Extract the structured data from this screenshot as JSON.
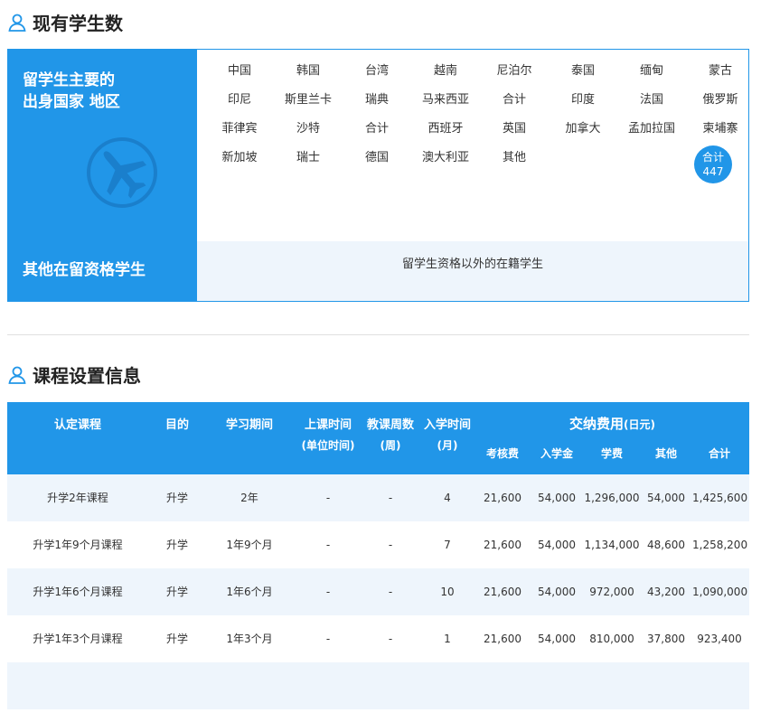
{
  "section1": {
    "title": "现有学生数"
  },
  "countries": {
    "heading_line1": "留学生主要的",
    "heading_line2": "出身国家 地区",
    "rows": [
      [
        "中国",
        "韩国",
        "台湾",
        "越南",
        "尼泊尔",
        "泰国",
        "缅甸",
        "蒙古"
      ],
      [
        "印尼",
        "斯里兰卡",
        "瑞典",
        "马来西亚",
        "合计",
        "印度",
        "法国",
        "俄罗斯"
      ],
      [
        "菲律宾",
        "沙特",
        "合计",
        "西班牙",
        "英国",
        "加拿大",
        "孟加拉国",
        "柬埔寨"
      ],
      [
        "新加坡",
        "瑞士",
        "德国",
        "澳大利亚",
        "其他",
        "",
        "",
        ""
      ]
    ],
    "total_label": "合计",
    "total_value": "447",
    "other_heading": "其他在留资格学生",
    "other_desc": "留学生资格以外的在籍学生"
  },
  "section2": {
    "title": "课程设置信息"
  },
  "course_table": {
    "headers": {
      "course": "认定课程",
      "purpose": "目的",
      "period": "学习期间",
      "class_time": "上课时间",
      "class_time_unit": "(单位时间)",
      "weeks": "教课周数",
      "weeks_unit": "(周)",
      "entry": "入学时间",
      "entry_unit": "(月)",
      "fees_group": "交纳费用",
      "fees_unit": "(日元)",
      "exam": "考核费",
      "admission": "入学金",
      "tuition": "学费",
      "other": "其他",
      "total": "合计"
    },
    "rows": [
      {
        "course": "升学2年课程",
        "purpose": "升学",
        "period": "2年",
        "class_time": "-",
        "weeks": "-",
        "entry": "4",
        "exam": "21,600",
        "admission": "54,000",
        "tuition": "1,296,000",
        "other": "54,000",
        "total": "1,425,600"
      },
      {
        "course": "升学1年9个月课程",
        "purpose": "升学",
        "period": "1年9个月",
        "class_time": "-",
        "weeks": "-",
        "entry": "7",
        "exam": "21,600",
        "admission": "54,000",
        "tuition": "1,134,000",
        "other": "48,600",
        "total": "1,258,200"
      },
      {
        "course": "升学1年6个月课程",
        "purpose": "升学",
        "period": "1年6个月",
        "class_time": "-",
        "weeks": "-",
        "entry": "10",
        "exam": "21,600",
        "admission": "54,000",
        "tuition": "972,000",
        "other": "43,200",
        "total": "1,090,000"
      },
      {
        "course": "升学1年3个月课程",
        "purpose": "升学",
        "period": "1年3个月",
        "class_time": "-",
        "weeks": "-",
        "entry": "1",
        "exam": "21,600",
        "admission": "54,000",
        "tuition": "810,000",
        "other": "37,800",
        "total": "923,400"
      }
    ]
  },
  "colors": {
    "accent": "#2196e8",
    "row_alt": "#eef5fc"
  },
  "icons": {
    "section": "user-icon",
    "decor": "plane-icon"
  }
}
